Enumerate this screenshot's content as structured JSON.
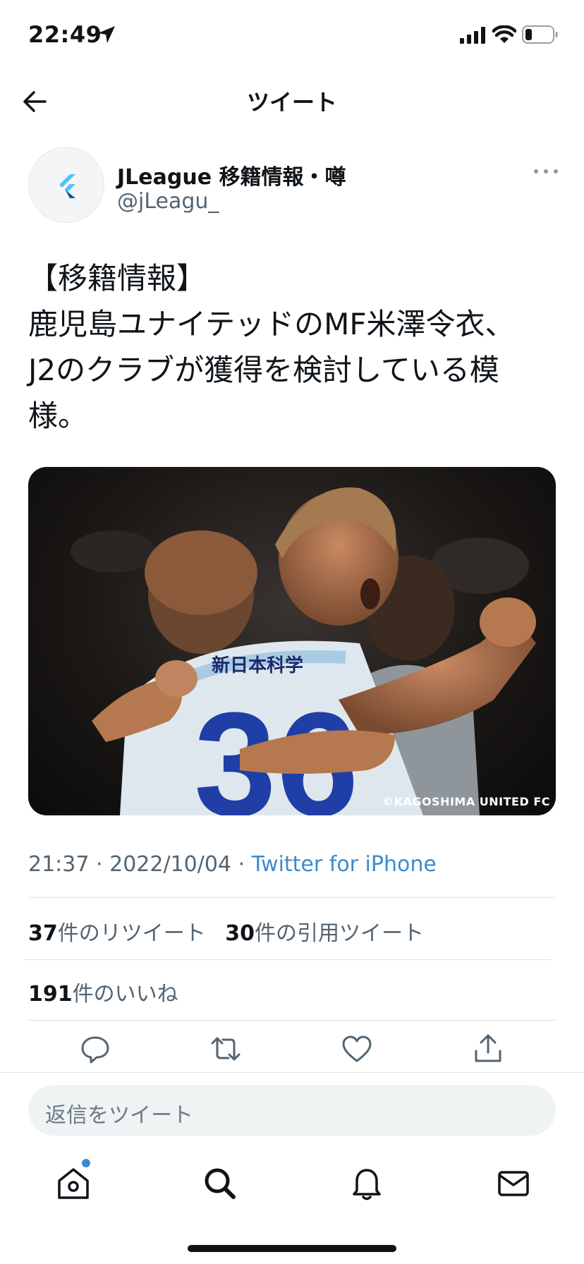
{
  "status": {
    "time": "22:49"
  },
  "nav": {
    "title": "ツイート"
  },
  "tweet": {
    "author_name": "JLeague 移籍情報・噂",
    "author_handle": "@jLeagu_",
    "text": "【移籍情報】\n鹿児島ユナイテッドのMF米澤令衣、\nJ2のクラブが獲得を検討している模\n様。",
    "media_credit": "©KAGOSHIMA UNITED FC",
    "time": "21:37",
    "date": "2022/10/04",
    "source": "Twitter for iPhone",
    "separator": "·"
  },
  "stats": {
    "retweets_count": "37",
    "retweets_label": "件のリツイート",
    "quotes_count": "30",
    "quotes_label": "件の引用ツイート",
    "likes_count": "191",
    "likes_label": "件のいいね"
  },
  "reply": {
    "placeholder": "返信をツイート"
  },
  "colors": {
    "accent": "#3b8bd0",
    "secondary_text": "#536471",
    "divider": "#dfe3e6"
  },
  "icons": {
    "back": "arrow-left-icon",
    "more": "more-horizontal-icon",
    "reply": "comment-icon",
    "retweet": "retweet-icon",
    "like": "heart-icon",
    "share": "share-icon",
    "home": "home-icon",
    "search": "search-icon",
    "notifications": "bell-icon",
    "messages": "mail-icon"
  }
}
